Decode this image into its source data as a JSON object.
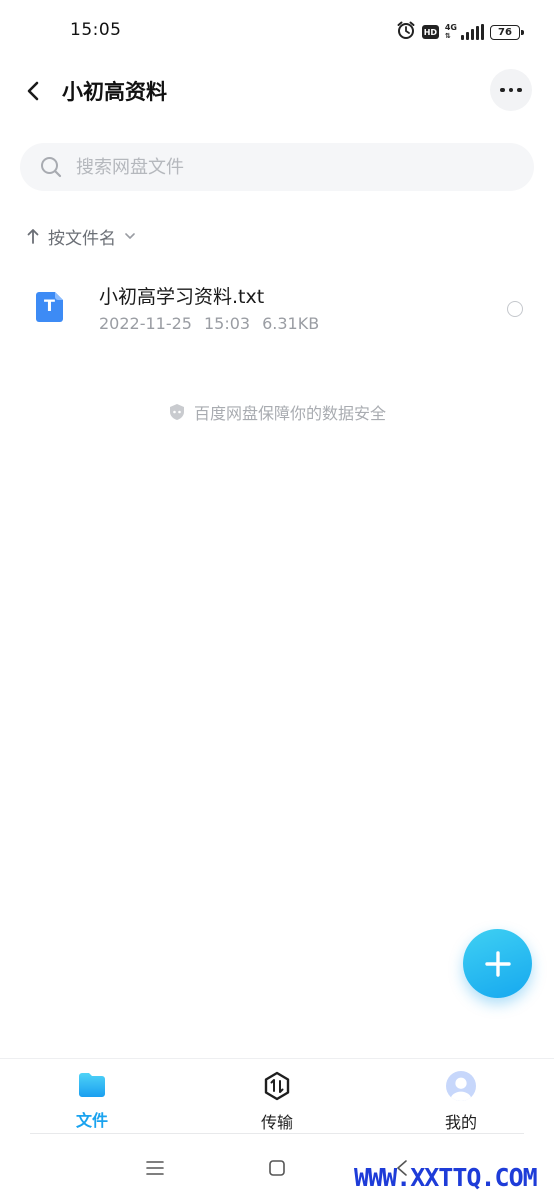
{
  "status_bar": {
    "time": "15:05",
    "icons": [
      "alarm-icon",
      "hd-icon",
      "4g-signal-icon",
      "battery-icon"
    ],
    "hd_label": "HD",
    "network_label": "4G",
    "battery_level": "76"
  },
  "header": {
    "title": "小初高资料",
    "back_icon": "chevron-left-icon",
    "more_icon": "more-horizontal-icon"
  },
  "search": {
    "placeholder": "搜索网盘文件",
    "icon": "search-icon"
  },
  "sort": {
    "label": "按文件名",
    "icons": [
      "arrow-up-icon",
      "chevron-down-icon"
    ]
  },
  "files": [
    {
      "name": "小初高学习资料.txt",
      "date": "2022-11-25",
      "time": "15:03",
      "size": "6.31KB",
      "icon": "txt-file-icon",
      "icon_letter": "T"
    }
  ],
  "safety_notice": "百度网盘保障你的数据安全",
  "fab_icon": "plus-icon",
  "tabs": [
    {
      "label": "文件",
      "icon": "folder-icon",
      "active": true
    },
    {
      "label": "传输",
      "icon": "transfer-icon",
      "active": false
    },
    {
      "label": "我的",
      "icon": "avatar-icon",
      "active": false
    }
  ],
  "system_nav": [
    "menu-icon",
    "home-square-icon",
    "back-icon"
  ],
  "watermark": "WWW.XXTTQ.COM",
  "colors": {
    "accent": "#1aa3ef",
    "file_icon": "#3d8bf5",
    "watermark": "#1e3cd8"
  }
}
